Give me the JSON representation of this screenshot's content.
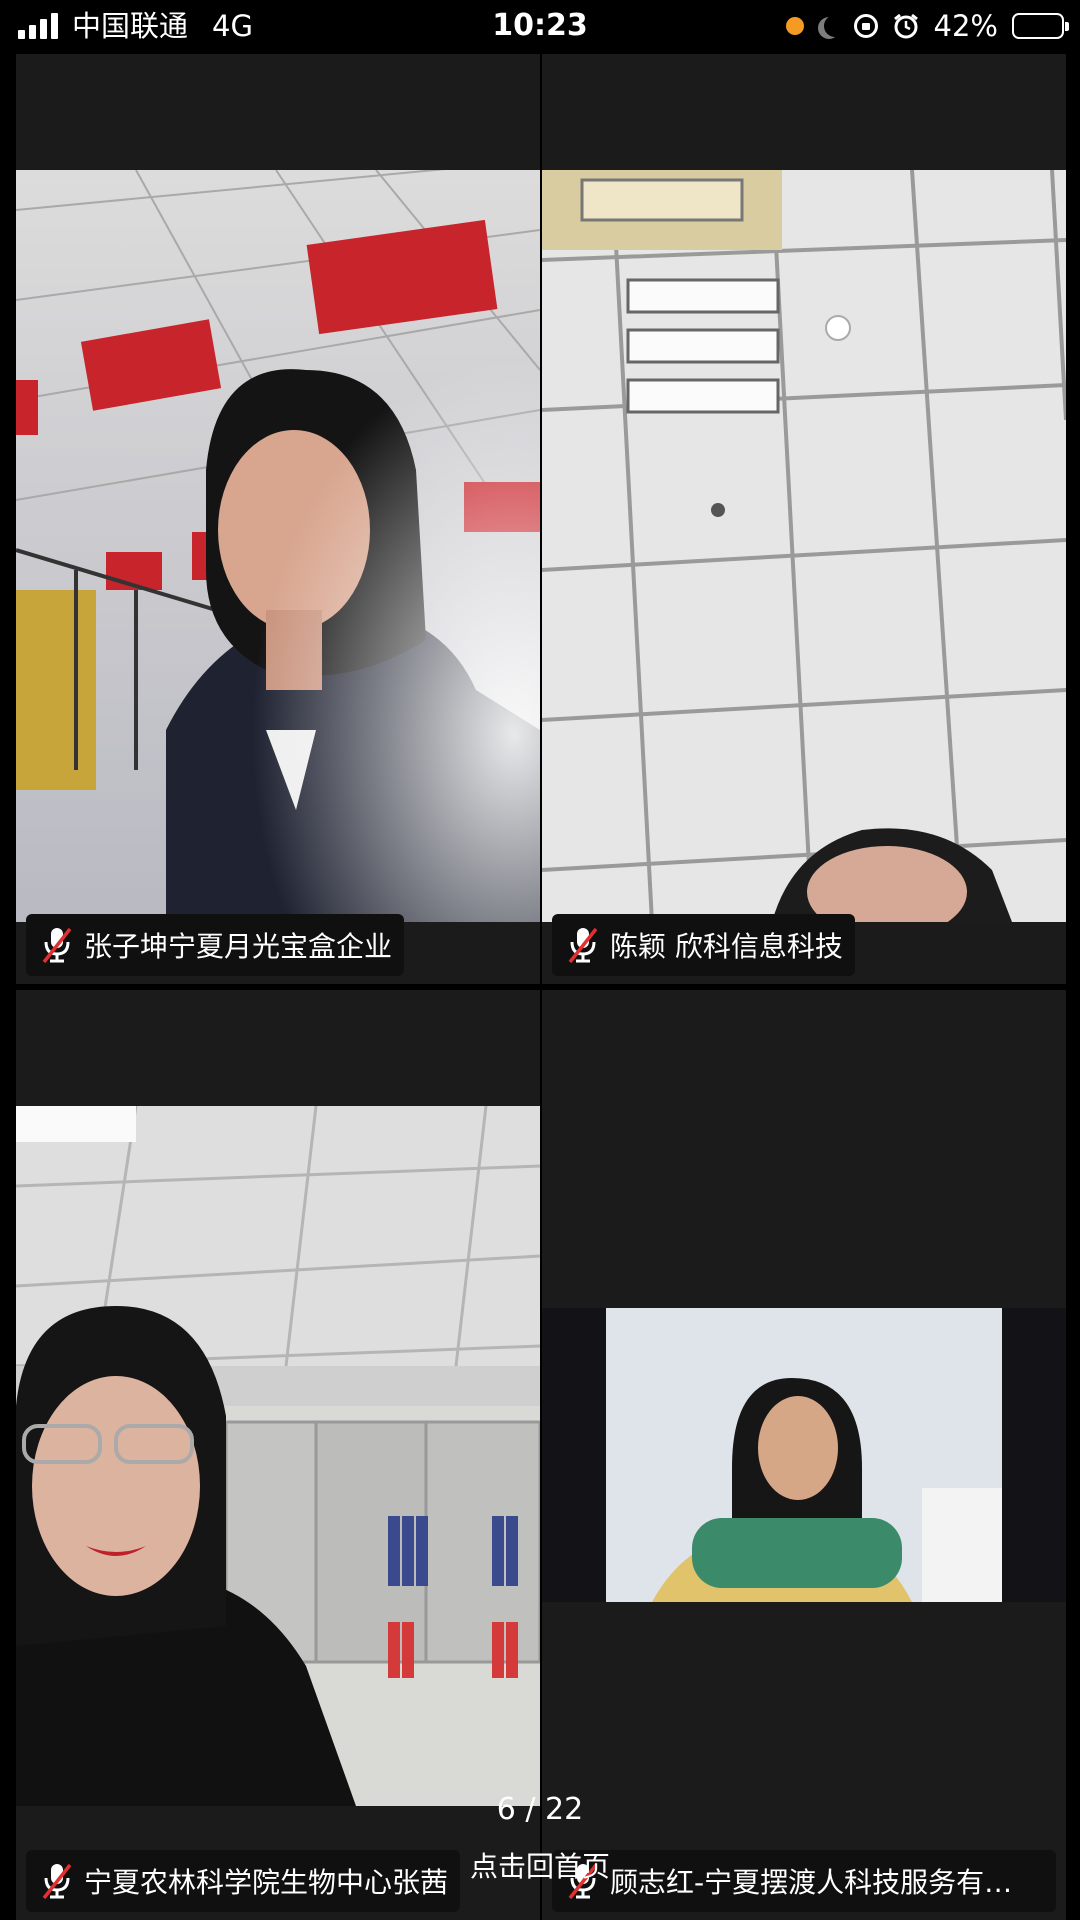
{
  "status_bar": {
    "carrier": "中国联通",
    "network": "4G",
    "time": "10:23",
    "battery": "42%",
    "battery_level": 0.42,
    "icons": [
      "signal-icon",
      "recording-dot-icon",
      "moon-icon",
      "rotation-lock-icon",
      "alarm-icon",
      "battery-icon"
    ]
  },
  "participants": [
    {
      "name": "张子坤宁夏月光宝盒企业",
      "mic": "mic-muted-icon"
    },
    {
      "name": "陈颖 欣科信息科技",
      "mic": "mic-muted-icon"
    },
    {
      "name": "宁夏农林科学院生物中心张茜",
      "mic": "mic-muted-icon"
    },
    {
      "name": "顾志红-宁夏摆渡人科技服务有…",
      "mic": "mic-muted-icon"
    }
  ],
  "pager": {
    "indicator": "6 / 22",
    "home_link": "点击回首页"
  },
  "colors": {
    "background": "#000000",
    "tile": "#1b1b1b",
    "mute_slash": "#e0302f",
    "recording_dot": "#f59a23"
  }
}
